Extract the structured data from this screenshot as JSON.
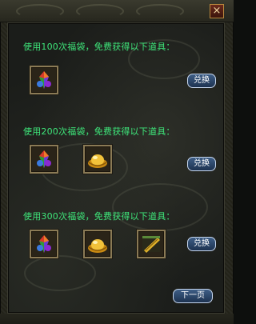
{
  "window": {
    "close_label": "×"
  },
  "rows": [
    {
      "label": "使用100次福袋，免费获得以下道具：",
      "items": [
        "gem-bag-icon"
      ],
      "button": "兑换"
    },
    {
      "label": "使用200次福袋，免费获得以下道具：",
      "items": [
        "gem-bag-icon",
        "gold-ingot-icon"
      ],
      "button": "兑换"
    },
    {
      "label": "使用300次福袋，免费获得以下道具：",
      "items": [
        "gem-bag-icon",
        "gold-ingot-icon",
        "scroll-icon"
      ],
      "button": "兑换"
    }
  ],
  "footer": {
    "next_page_label": "下一页"
  },
  "colors": {
    "label_text": "#3ee67a",
    "button_fill": "#2a4a70",
    "slot_border": "#8a7a55"
  }
}
